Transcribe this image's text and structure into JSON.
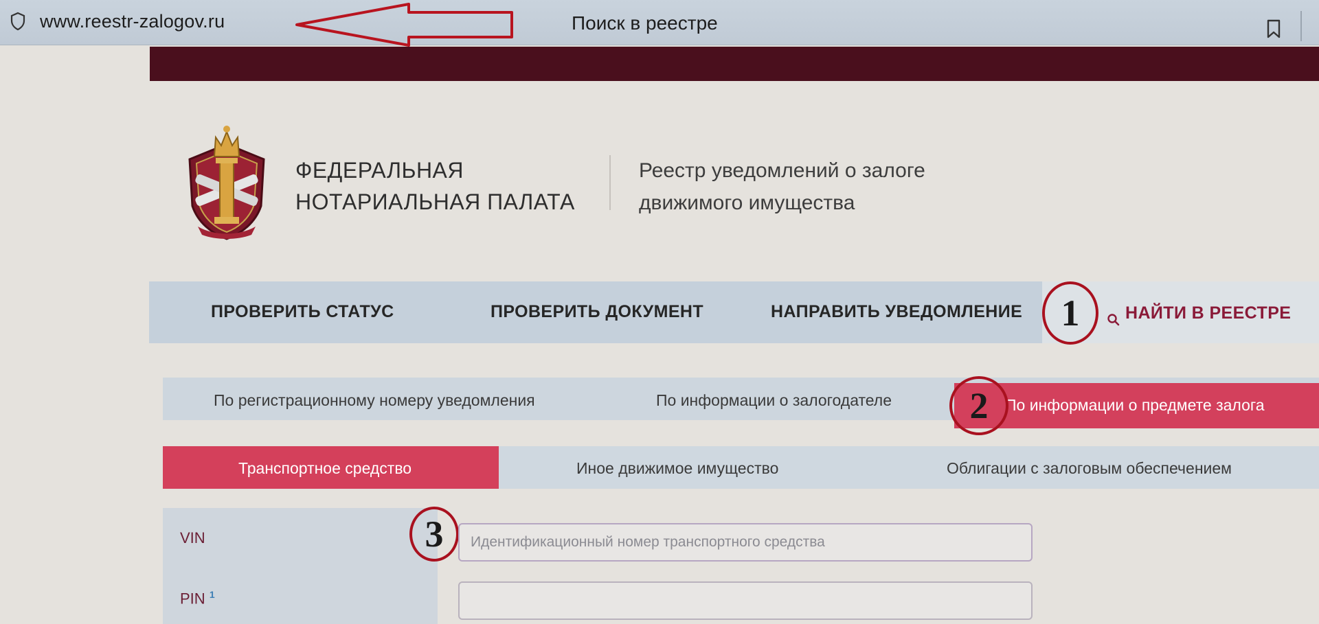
{
  "browser": {
    "url": "www.reestr-zalogov.ru",
    "title": "Поиск в реестре"
  },
  "header": {
    "org_line1": "ФЕДЕРАЛЬНАЯ",
    "org_line2": "НОТАРИАЛЬНАЯ ПАЛАТА",
    "registry_line1": "Реестр уведомлений о залоге",
    "registry_line2": "движимого имущества"
  },
  "main_nav": {
    "items": [
      {
        "label": "ПРОВЕРИТЬ СТАТУС"
      },
      {
        "label": "ПРОВЕРИТЬ ДОКУМЕНТ"
      },
      {
        "label": "НАПРАВИТЬ УВЕДОМЛЕНИЕ"
      }
    ],
    "search_label": "НАЙТИ В РЕЕСТРЕ"
  },
  "search_tabs": {
    "items": [
      {
        "label": "По регистрационному номеру уведомления"
      },
      {
        "label": "По информации о залогодателе"
      },
      {
        "label": "По информации о предмете залога",
        "active": true
      }
    ]
  },
  "property_tabs": {
    "items": [
      {
        "label": "Транспортное средство",
        "active": true
      },
      {
        "label": "Иное движимое имущество"
      },
      {
        "label": "Облигации с залоговым обеспечением"
      }
    ]
  },
  "form": {
    "vin_label": "VIN",
    "vin_placeholder": "Идентификационный номер транспортного средства",
    "vin_value": "",
    "pin_label": "PIN",
    "pin_footnote": "1",
    "pin_value": ""
  },
  "annotations": {
    "marker_1": "1",
    "marker_2": "2",
    "marker_3": "3"
  },
  "colors": {
    "brand_dark": "#4a0f1d",
    "accent_red": "#d4405b",
    "nav_bg": "#c5d0db",
    "search_link": "#8a1a38",
    "annotation_red": "#a9111f"
  }
}
